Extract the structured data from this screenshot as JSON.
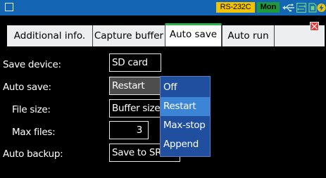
{
  "status_bar": {
    "interface_badge": "RS-232C",
    "mode_badge": "Mon",
    "icons": [
      "window-icon",
      "usb-icon",
      "network-icon",
      "sd-card-icon",
      "power-icon"
    ],
    "colors": {
      "bar": "#1466b4",
      "interface_badge": "#f2c400",
      "mode_badge": "#1f9a3a"
    }
  },
  "tabs": [
    {
      "label": "Additional info."
    },
    {
      "label": "Capture buffer"
    },
    {
      "label": "Auto save",
      "active": true
    },
    {
      "label": "Auto run"
    }
  ],
  "settings": {
    "save_device": {
      "label": "Save device:",
      "value": "SD card"
    },
    "auto_save": {
      "label": "Auto save:",
      "value": "Restart"
    },
    "file_size": {
      "label": "File size:",
      "value": "Buffer size"
    },
    "max_files": {
      "label": "Max files:",
      "value": "3"
    },
    "auto_backup": {
      "label": "Auto backup:",
      "value": "Save to SRAM"
    }
  },
  "dropdown": {
    "options": [
      "Off",
      "Restart",
      "Max-stop",
      "Append"
    ],
    "selected": "Restart",
    "colors": {
      "background": "#1f4f9e",
      "highlight": "#3c84d6"
    }
  }
}
